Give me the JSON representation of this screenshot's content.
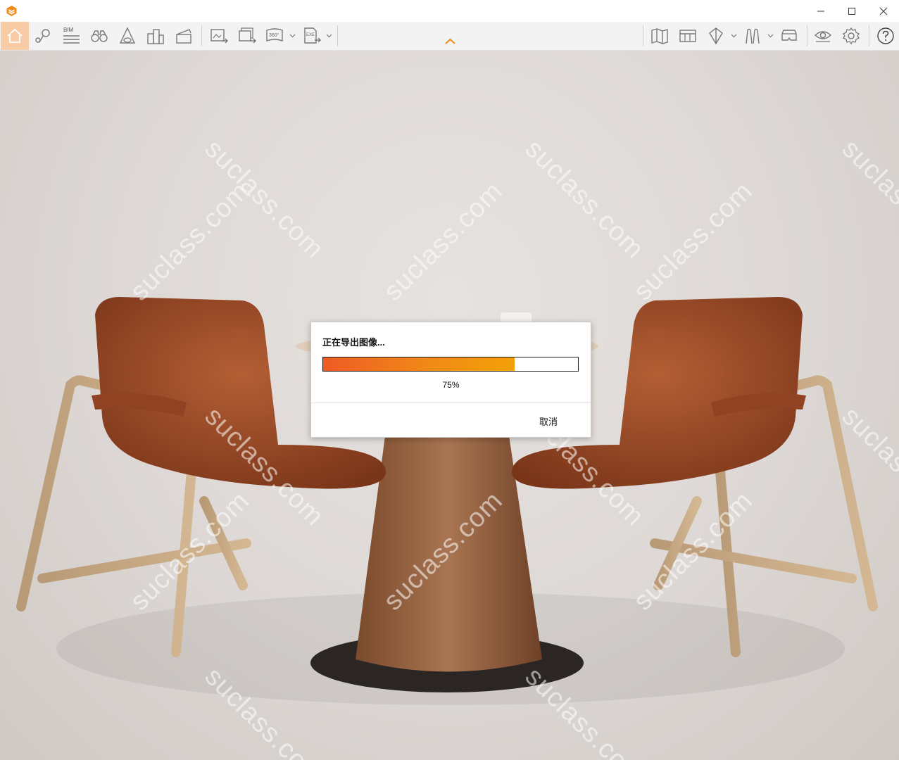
{
  "window": {
    "toolbar_label_bim": "BIM",
    "toolbar_label_360": "360°",
    "toolbar_label_exe": "EXE"
  },
  "colors": {
    "accent": "#f08a18",
    "home_active_bg": "#f9cba5",
    "progress_start": "#ee5a24",
    "progress_end": "#f3a006"
  },
  "viewport": {
    "watermark_text": "suclass.com"
  },
  "dialog": {
    "title": "正在导出图像...",
    "progress_value": 0.75,
    "progress_text": "75%",
    "cancel_label": "取消"
  }
}
